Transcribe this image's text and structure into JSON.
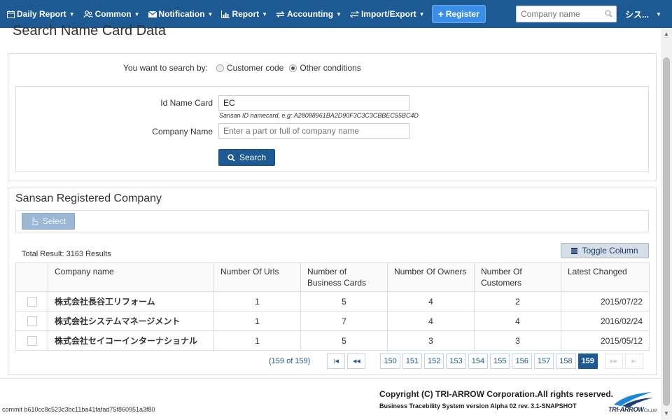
{
  "nav": {
    "items": [
      {
        "label": "Daily Report",
        "icon": "calendar-icon"
      },
      {
        "label": "Common",
        "icon": "users-icon"
      },
      {
        "label": "Notification",
        "icon": "envelope-icon"
      },
      {
        "label": "Report",
        "icon": "bar-chart-icon"
      },
      {
        "label": "Accounting",
        "icon": "exchange-icon"
      },
      {
        "label": "Import/Export",
        "icon": "transfer-icon"
      }
    ],
    "register_label": "Register",
    "search_placeholder": "Company name",
    "user_label": "シス..."
  },
  "page_title": "Search Name Card Data",
  "search_by": {
    "label": "You want to search by:",
    "options": [
      {
        "label": "Customer code",
        "checked": false
      },
      {
        "label": "Other conditions",
        "checked": true
      }
    ]
  },
  "form": {
    "id_label": "Id Name Card",
    "id_value": "EC",
    "id_hint": "Sansan ID namecard, e.g: A28088961BA2D90F3C3C3CBBEC55BC4D",
    "company_label": "Company Name",
    "company_placeholder": "Enter a part or full of company name",
    "search_button": "Search"
  },
  "results": {
    "title": "Sansan Registered Company",
    "select_button": "Select",
    "total": "Total Result: 3163 Results",
    "toggle_button": "Toggle Column",
    "columns": [
      "Company name",
      "Number Of Urls",
      "Number of Business Cards",
      "Number Of Owners",
      "Number Of Customers",
      "Latest Changed"
    ],
    "rows": [
      {
        "name": "株式会社長谷工リフォーム",
        "urls": "1",
        "cards": "5",
        "owners": "4",
        "customers": "2",
        "changed": "2015/07/22"
      },
      {
        "name": "株式会社システムマネージメント",
        "urls": "1",
        "cards": "7",
        "owners": "4",
        "customers": "4",
        "changed": "2016/02/24"
      },
      {
        "name": "株式会社セイコーインターナショナル",
        "urls": "1",
        "cards": "5",
        "owners": "3",
        "customers": "3",
        "changed": "2015/05/12"
      }
    ]
  },
  "pager": {
    "info": "(159 of 159)",
    "first": "|◀",
    "prev": "◀◀",
    "pages": [
      "150",
      "151",
      "152",
      "153",
      "154",
      "155",
      "156",
      "157",
      "158",
      "159"
    ],
    "current": "159",
    "next": "▶▶",
    "last": "▶|"
  },
  "footer": {
    "commit": "commit b610cc8c523c3bc11ba41fafad75f860951a3f80",
    "copyright": "Copyright (C) TRI-ARROW Corporation.All rights reserved.",
    "version": "Business Tracebility System version Alpha 02 rev. 3.1-SNAPSHOT",
    "logo_text": "TRI-ARROW",
    "logo_suffix": "Co.,Ltd"
  },
  "colors": {
    "navbar": "#1d5a94",
    "primary_button": "#1d5a94",
    "register_button": "#3b8ee6"
  }
}
